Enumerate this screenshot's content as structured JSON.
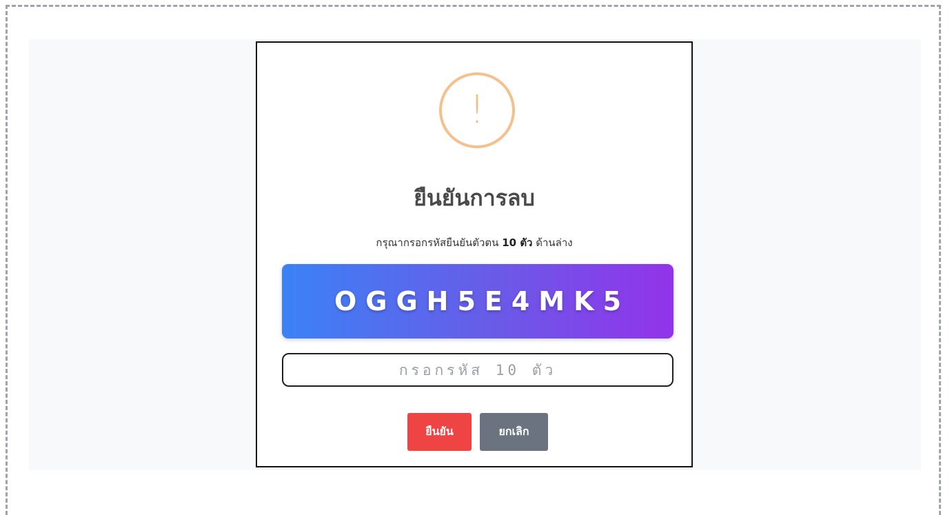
{
  "dialog": {
    "icon": "warning-exclamation-icon",
    "icon_glyph": "!",
    "icon_color": "#f3c08e",
    "title": "ยืนยันการลบ",
    "instruction_prefix": "กรุณากรอกรหัสยืนยันตัวตน",
    "instruction_count": "10 ตัว",
    "instruction_suffix": "ด้านล่าง",
    "verification_code": "OGGH5E4MK5",
    "code_gradient": [
      "#3b82f6",
      "#9333ea"
    ],
    "input": {
      "placeholder": "กรอกรหัส 10 ตัว",
      "value": ""
    },
    "confirm_label": "ยืนยัน",
    "confirm_color": "#ef4444",
    "cancel_label": "ยกเลิก",
    "cancel_color": "#6b7280"
  }
}
